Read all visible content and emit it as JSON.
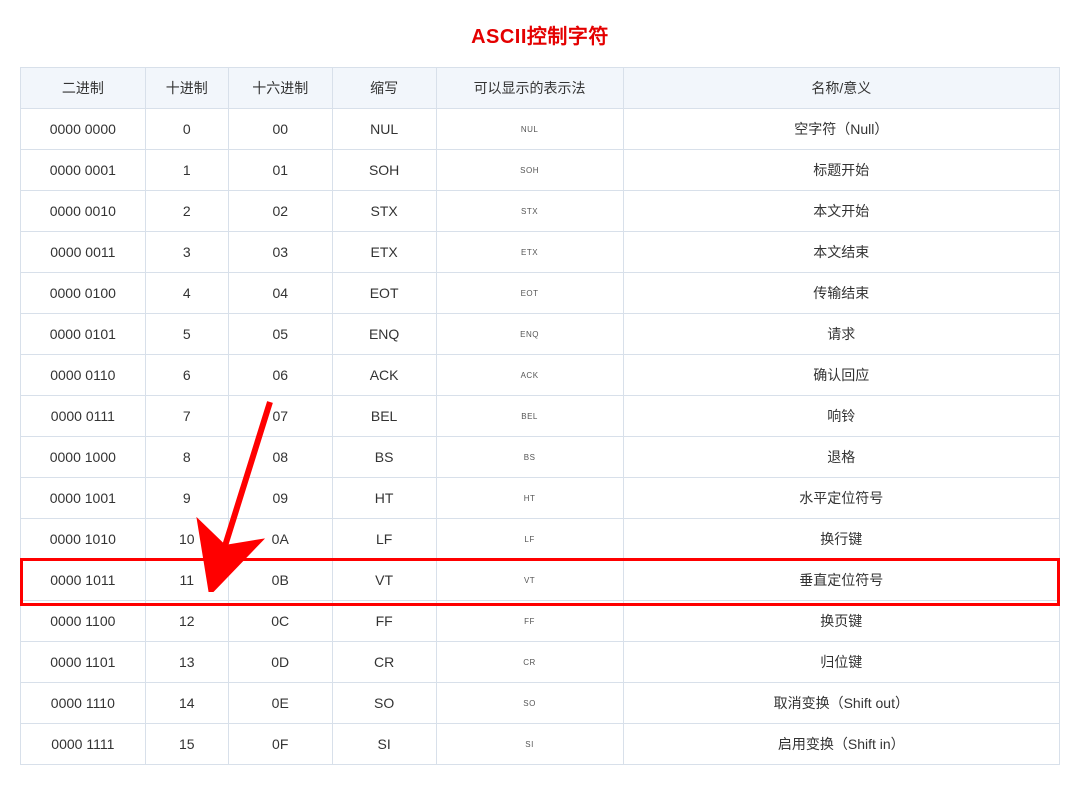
{
  "title": "ASCII控制字符",
  "columns": [
    "二进制",
    "十进制",
    "十六进制",
    "缩写",
    "可以显示的表示法",
    "名称/意义"
  ],
  "highlight_index": 11,
  "rows": [
    {
      "bin": "0000 0000",
      "dec": "0",
      "hex": "00",
      "abbr": "NUL",
      "rep": "NUL",
      "name": "空字符（Null）"
    },
    {
      "bin": "0000 0001",
      "dec": "1",
      "hex": "01",
      "abbr": "SOH",
      "rep": "SOH",
      "name": "标题开始"
    },
    {
      "bin": "0000 0010",
      "dec": "2",
      "hex": "02",
      "abbr": "STX",
      "rep": "STX",
      "name": "本文开始"
    },
    {
      "bin": "0000 0011",
      "dec": "3",
      "hex": "03",
      "abbr": "ETX",
      "rep": "ETX",
      "name": "本文结束"
    },
    {
      "bin": "0000 0100",
      "dec": "4",
      "hex": "04",
      "abbr": "EOT",
      "rep": "EOT",
      "name": "传输结束"
    },
    {
      "bin": "0000 0101",
      "dec": "5",
      "hex": "05",
      "abbr": "ENQ",
      "rep": "ENQ",
      "name": "请求"
    },
    {
      "bin": "0000 0110",
      "dec": "6",
      "hex": "06",
      "abbr": "ACK",
      "rep": "ACK",
      "name": "确认回应"
    },
    {
      "bin": "0000 0111",
      "dec": "7",
      "hex": "07",
      "abbr": "BEL",
      "rep": "BEL",
      "name": "响铃"
    },
    {
      "bin": "0000 1000",
      "dec": "8",
      "hex": "08",
      "abbr": "BS",
      "rep": "BS",
      "name": "退格"
    },
    {
      "bin": "0000 1001",
      "dec": "9",
      "hex": "09",
      "abbr": "HT",
      "rep": "HT",
      "name": "水平定位符号"
    },
    {
      "bin": "0000 1010",
      "dec": "10",
      "hex": "0A",
      "abbr": "LF",
      "rep": "LF",
      "name": "换行键"
    },
    {
      "bin": "0000 1011",
      "dec": "11",
      "hex": "0B",
      "abbr": "VT",
      "rep": "VT",
      "name": "垂直定位符号"
    },
    {
      "bin": "0000 1100",
      "dec": "12",
      "hex": "0C",
      "abbr": "FF",
      "rep": "FF",
      "name": "换页键"
    },
    {
      "bin": "0000 1101",
      "dec": "13",
      "hex": "0D",
      "abbr": "CR",
      "rep": "CR",
      "name": "归位键"
    },
    {
      "bin": "0000 1110",
      "dec": "14",
      "hex": "0E",
      "abbr": "SO",
      "rep": "SO",
      "name": "取消变换（Shift out）"
    },
    {
      "bin": "0000 1111",
      "dec": "15",
      "hex": "0F",
      "abbr": "SI",
      "rep": "SI",
      "name": "启用变换（Shift in）"
    }
  ]
}
